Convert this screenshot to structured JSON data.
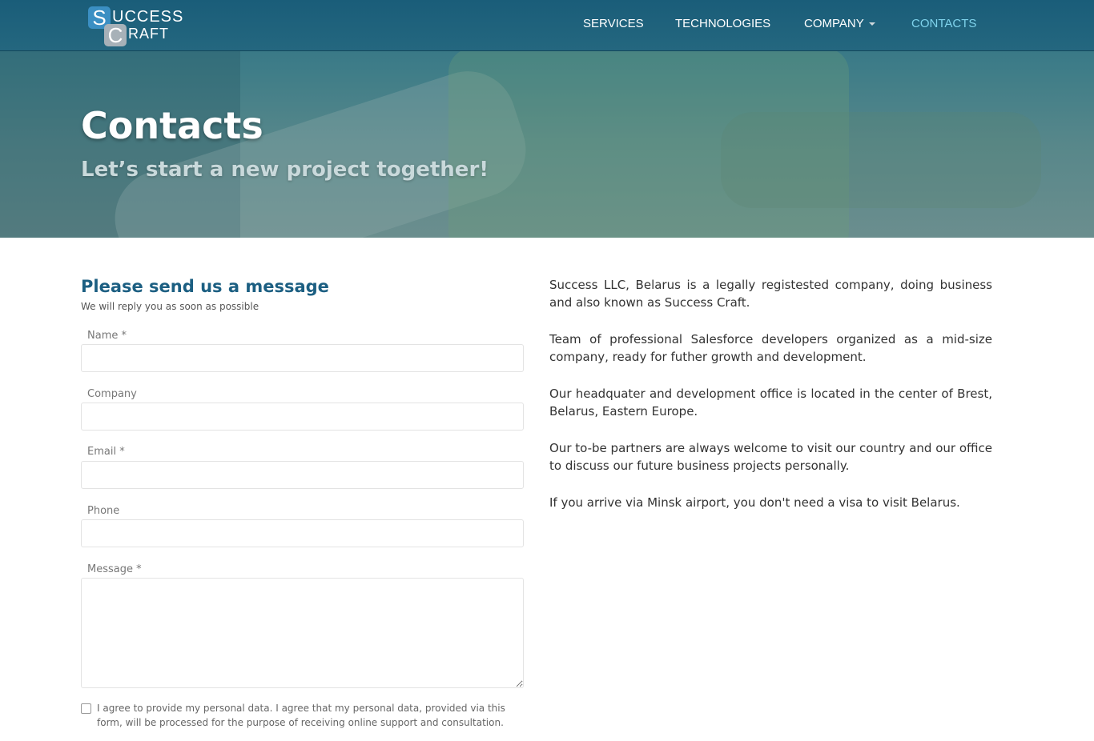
{
  "brand": {
    "logo_letter_1": "S",
    "logo_word_1": "UCCESS",
    "logo_letter_2": "C",
    "logo_word_2": "RAFT"
  },
  "nav": {
    "services": "SERVICES",
    "technologies": "TECHNOLOGIES",
    "company": "COMPANY",
    "contacts": "CONTACTS"
  },
  "hero": {
    "title": "Contacts",
    "subtitle": "Let’s start a new project together!"
  },
  "form": {
    "title": "Please send us a message",
    "subtitle": "We will reply you as soon as possible",
    "name_label": "Name *",
    "company_label": "Company",
    "email_label": "Email *",
    "phone_label": "Phone",
    "message_label": "Message *",
    "consent": "I agree to provide my personal data. I agree that my personal data, provided via this form, will be processed for the purpose of receiving online support and consultation."
  },
  "info": {
    "p1": "Success LLC, Belarus is a legally registested company, doing business and also known as Success Craft.",
    "p2": "Team of professional Salesforce developers organized as a mid-size company, ready for futher growth and development.",
    "p3": "Our headquater and development office is located in the center of Brest, Belarus, Eastern Europe.",
    "p4": "Our to-be partners are always welcome to visit our country and our office to discuss our future business projects personally.",
    "p5": "If you arrive via Minsk airport, you don't need a visa to visit Belarus."
  },
  "colors": {
    "topbar": "#1a5d79",
    "nav_active": "#7fd3ec",
    "form_title": "#1c5f82"
  },
  "icons": {
    "logo": "success-craft-logo",
    "dropdown": "caret-down-icon"
  }
}
